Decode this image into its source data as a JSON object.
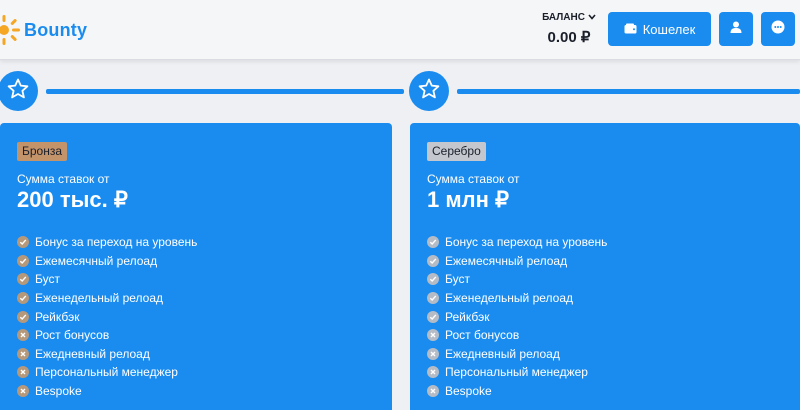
{
  "header": {
    "logo_text": "Bounty",
    "balance_label": "БАЛАНС",
    "balance_value": "0.00 ₽",
    "wallet_label": "Кошелек"
  },
  "colors": {
    "primary": "#1a8cf0",
    "bronze": "#c3936a",
    "silver": "#c4c8ce",
    "icon_bronze": "#b6987a",
    "icon_silver": "#b5bcc6"
  },
  "levels": [
    {
      "badge": "Бронза",
      "tier": "bronze",
      "sum_label": "Сумма ставок от",
      "sum_value": "200 тыс. ₽",
      "features": [
        {
          "label": "Бонус за переход на уровень",
          "included": true
        },
        {
          "label": "Ежемесячный релоад",
          "included": true
        },
        {
          "label": "Буст",
          "included": true
        },
        {
          "label": "Еженедельный релоад",
          "included": true
        },
        {
          "label": "Рейкбэк",
          "included": true
        },
        {
          "label": "Рост бонусов",
          "included": false
        },
        {
          "label": "Ежедневный релоад",
          "included": false
        },
        {
          "label": "Персональный менеджер",
          "included": false
        },
        {
          "label": "Bespoke",
          "included": false
        }
      ]
    },
    {
      "badge": "Серебро",
      "tier": "silver",
      "sum_label": "Сумма ставок от",
      "sum_value": "1 млн ₽",
      "features": [
        {
          "label": "Бонус за переход на уровень",
          "included": true
        },
        {
          "label": "Ежемесячный релоад",
          "included": true
        },
        {
          "label": "Буст",
          "included": true
        },
        {
          "label": "Еженедельный релоад",
          "included": true
        },
        {
          "label": "Рейкбэк",
          "included": true
        },
        {
          "label": "Рост бонусов",
          "included": false
        },
        {
          "label": "Ежедневный релоад",
          "included": false
        },
        {
          "label": "Персональный менеджер",
          "included": false
        },
        {
          "label": "Bespoke",
          "included": false
        }
      ]
    }
  ]
}
